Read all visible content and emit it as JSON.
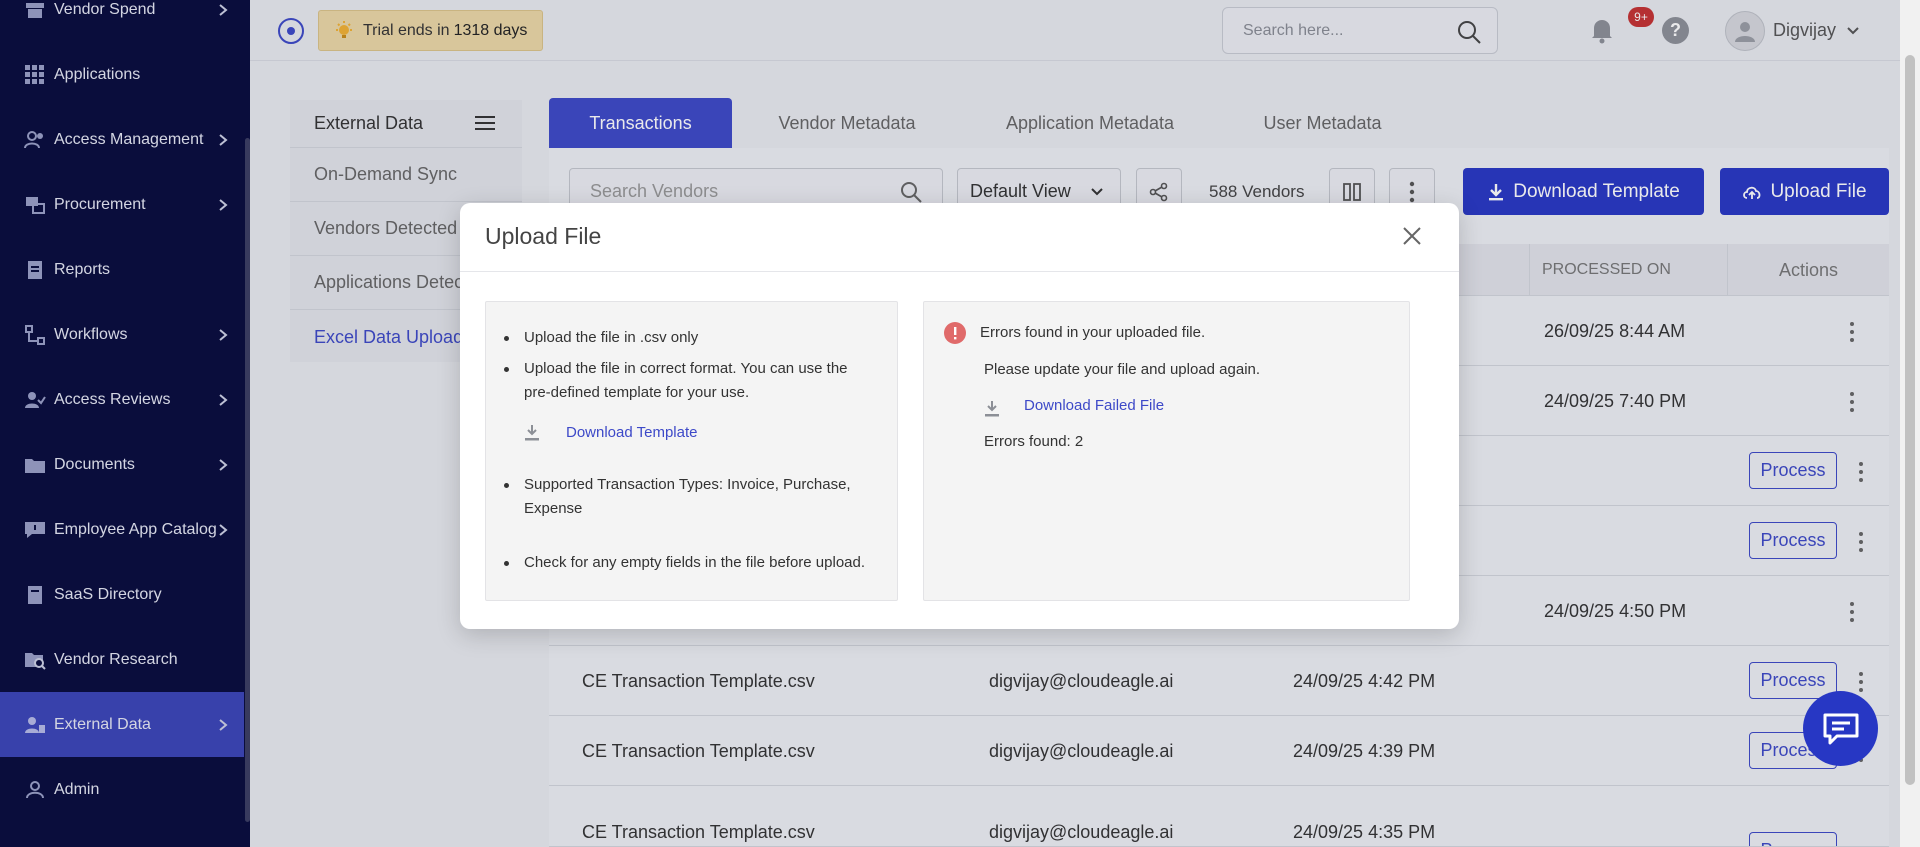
{
  "sidebar": {
    "items": [
      {
        "label": "Vendor Spend",
        "icon": "store-icon",
        "chevron": true
      },
      {
        "label": "Applications",
        "icon": "grid-icon",
        "chevron": false
      },
      {
        "label": "Access Management",
        "icon": "users-icon",
        "chevron": true
      },
      {
        "label": "Procurement",
        "icon": "procurement-icon",
        "chevron": true
      },
      {
        "label": "Reports",
        "icon": "report-icon",
        "chevron": false
      },
      {
        "label": "Workflows",
        "icon": "workflow-icon",
        "chevron": true
      },
      {
        "label": "Access Reviews",
        "icon": "user-check-icon",
        "chevron": true
      },
      {
        "label": "Documents",
        "icon": "folder-icon",
        "chevron": true
      },
      {
        "label": "Employee App Catalog",
        "icon": "catalog-icon",
        "chevron": true
      },
      {
        "label": "SaaS Directory",
        "icon": "book-icon",
        "chevron": false
      },
      {
        "label": "Vendor Research",
        "icon": "folder-search-icon",
        "chevron": false
      },
      {
        "label": "External Data",
        "icon": "user-data-icon",
        "chevron": true,
        "active": true
      },
      {
        "label": "Admin",
        "icon": "user-icon",
        "chevron": false
      }
    ]
  },
  "topbar": {
    "trial_prefix": "Trial ends in",
    "trial_days": "1318 days",
    "search_placeholder": "Search here...",
    "notification_count": "9+",
    "help": "?",
    "username": "Digvijay"
  },
  "ext_panel": {
    "title": "External Data",
    "items": [
      "On-Demand Sync",
      "Vendors Detected",
      "Applications Detected",
      "Excel Data Upload"
    ]
  },
  "tabs": [
    "Transactions",
    "Vendor Metadata",
    "Application Metadata",
    "User Metadata"
  ],
  "toolbar": {
    "search_placeholder": "Search Vendors",
    "view": "Default View",
    "vendor_count": "588 Vendors",
    "download_template": "Download Template",
    "upload_file": "Upload File"
  },
  "table": {
    "headers": {
      "processed_on": "PROCESSED ON",
      "actions": "Actions"
    },
    "rows": [
      {
        "file": "",
        "user": "",
        "uploaded": "",
        "processed": "26/09/25 8:44 AM",
        "process": false
      },
      {
        "file": "",
        "user": "",
        "uploaded": "",
        "processed": "24/09/25 7:40 PM",
        "process": false
      },
      {
        "file": "",
        "user": "",
        "uploaded": "",
        "processed": "",
        "process": true
      },
      {
        "file": "",
        "user": "",
        "uploaded": "",
        "processed": "",
        "process": true
      },
      {
        "file": "",
        "user": "",
        "uploaded": "",
        "processed": "24/09/25 4:50 PM",
        "process": false
      },
      {
        "file": "CE Transaction Template.csv",
        "user": "digvijay@cloudeagle.ai",
        "uploaded": "24/09/25 4:42 PM",
        "processed": "",
        "process": true
      },
      {
        "file": "CE Transaction Template.csv",
        "user": "digvijay@cloudeagle.ai",
        "uploaded": "24/09/25 4:39 PM",
        "processed": "",
        "process": true
      },
      {
        "file": "CE Transaction Template.csv",
        "user": "digvijay@cloudeagle.ai",
        "uploaded": "24/09/25 4:35 PM",
        "processed": "",
        "process": true
      }
    ],
    "process_label": "Process"
  },
  "modal": {
    "title": "Upload File",
    "instructions": {
      "b1": "Upload the file in .csv only",
      "b2_line1": "Upload the file in correct format. You can use the",
      "b2_line2": "pre-defined template for your use.",
      "download_template": "Download Template",
      "b3_line1": "Supported Transaction Types: Invoice, Purchase,",
      "b3_line2": "Expense",
      "b4": "Check for any empty fields in the file before upload."
    },
    "errors": {
      "heading": "Errors found in your uploaded file.",
      "sub": "Please update your file and upload again.",
      "download_failed": "Download Failed File",
      "count": "Errors found: 2"
    }
  },
  "colors": {
    "primary": "#2737c4",
    "sidebar_bg": "#070b3d",
    "error": "#e06a6a"
  }
}
